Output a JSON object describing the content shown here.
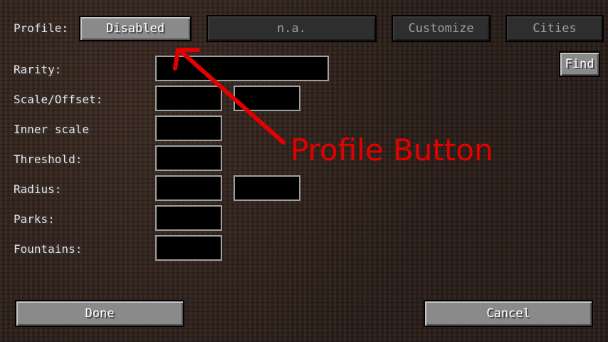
{
  "top_bar": {
    "profile_label": "Profile:",
    "profile_button": "Disabled",
    "na_button": "n.a.",
    "customize_button": "Customize",
    "cities_button": "Cities"
  },
  "find_button": "Find",
  "fields": {
    "rarity_label": "Rarity:",
    "scale_offset_label": "Scale/Offset:",
    "inner_scale_label": "Inner scale",
    "threshold_label": "Threshold:",
    "radius_label": "Radius:",
    "parks_label": "Parks:",
    "fountains_label": "Fountains:"
  },
  "footer": {
    "done_button": "Done",
    "cancel_button": "Cancel"
  },
  "annotation": {
    "text": "Profile Button",
    "color": "#e50000"
  }
}
